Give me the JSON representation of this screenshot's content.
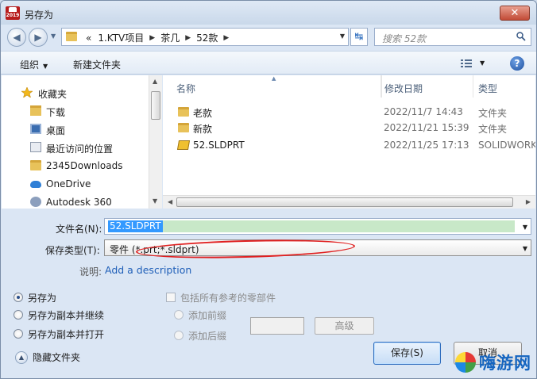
{
  "window": {
    "title": "另存为",
    "close_glyph": "✕",
    "app_icon_text": "2019"
  },
  "nav": {
    "back_glyph": "◀",
    "forward_glyph": "▶",
    "dropdown_glyph": "▼",
    "breadcrumb_prefix": "«",
    "breadcrumbs": [
      "1.KTV项目",
      "茶几",
      "52款"
    ],
    "crumb_sep": "▶",
    "address_dropdown": "▼",
    "refresh_glyph": "↹",
    "search_placeholder": "搜索 52款"
  },
  "toolbar": {
    "organize_label": "组织",
    "organize_caret": "▼",
    "new_folder_label": "新建文件夹",
    "view_caret": "▼",
    "help_glyph": "?"
  },
  "sidebar": {
    "favorites_label": "收藏夹",
    "items": [
      {
        "label": "下载",
        "icon": "download-folder-icon"
      },
      {
        "label": "桌面",
        "icon": "desktop-icon"
      },
      {
        "label": "最近访问的位置",
        "icon": "recent-places-icon"
      },
      {
        "label": "2345Downloads",
        "icon": "folder-icon"
      },
      {
        "label": "OneDrive",
        "icon": "onedrive-icon"
      },
      {
        "label": "Autodesk 360",
        "icon": "autodesk-360-icon"
      }
    ],
    "scroll_up": "▲",
    "scroll_down": "▼"
  },
  "files": {
    "columns": [
      "名称",
      "修改日期",
      "类型"
    ],
    "sort_glyph": "▲",
    "rows": [
      {
        "name": "老款",
        "date": "2022/11/7 14:43",
        "type": "文件夹",
        "icon": "folder-icon"
      },
      {
        "name": "新款",
        "date": "2022/11/21 15:39",
        "type": "文件夹",
        "icon": "folder-icon"
      },
      {
        "name": "52.SLDPRT",
        "date": "2022/11/25 17:13",
        "type": "SOLIDWORKS",
        "icon": "solidworks-part-icon"
      }
    ],
    "hscroll_left": "◀",
    "hscroll_right": "▶"
  },
  "form": {
    "filename_label": "文件名(N):",
    "filename_value": "52.SLDPRT",
    "filetype_label": "保存类型(T):",
    "filetype_value": "零件 (*.prt;*.sldprt)",
    "dropdown_glyph": "▼",
    "desc_label": "说明:",
    "desc_link": "Add a description"
  },
  "options": {
    "save_as": "另存为",
    "save_as_copy_continue": "另存为副本并继续",
    "save_as_copy_open": "另存为副本并打开",
    "include_refs": "包括所有参考的零部件",
    "add_prefix": "添加前缀",
    "add_suffix": "添加后缀",
    "advanced": "高级"
  },
  "buttons": {
    "save": "保存(S)",
    "cancel": "取消",
    "hide_folders": "隐藏文件夹",
    "hide_glyph": "▲"
  },
  "watermark": {
    "text": "嗨游网"
  }
}
